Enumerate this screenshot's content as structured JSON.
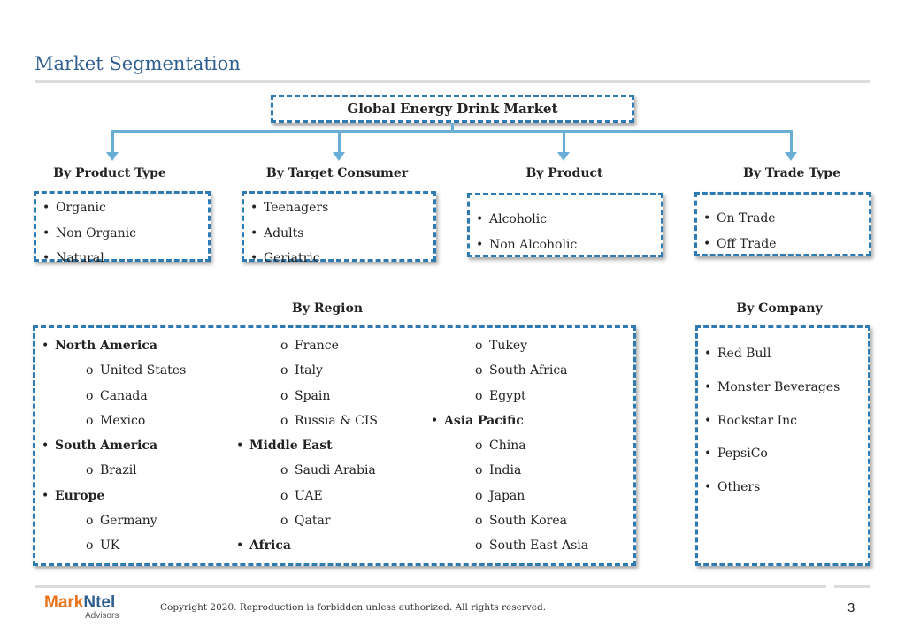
{
  "page": {
    "title": "Market Segmentation"
  },
  "diagram": {
    "root": "Global Energy Drink Market",
    "segments": [
      {
        "heading": "By Product Type",
        "items": [
          "Organic",
          "Non Organic",
          "Natural"
        ]
      },
      {
        "heading": "By Target Consumer",
        "items": [
          "Teenagers",
          "Adults",
          "Geriatric"
        ]
      },
      {
        "heading": "By Product",
        "items": [
          "Alcoholic",
          "Non Alcoholic"
        ]
      },
      {
        "heading": "By Trade Type",
        "items": [
          "On Trade",
          "Off Trade"
        ]
      }
    ],
    "region": {
      "heading": "By Region",
      "columns": [
        [
          {
            "label": "North America",
            "level": "top"
          },
          {
            "label": "United States",
            "level": "sub"
          },
          {
            "label": "Canada",
            "level": "sub"
          },
          {
            "label": "Mexico",
            "level": "sub"
          },
          {
            "label": "South America",
            "level": "top"
          },
          {
            "label": "Brazil",
            "level": "sub"
          },
          {
            "label": "Europe",
            "level": "top"
          },
          {
            "label": "Germany",
            "level": "sub"
          },
          {
            "label": "UK",
            "level": "sub"
          }
        ],
        [
          {
            "label": "France",
            "level": "sub"
          },
          {
            "label": "Italy",
            "level": "sub"
          },
          {
            "label": "Spain",
            "level": "sub"
          },
          {
            "label": "Russia & CIS",
            "level": "sub"
          },
          {
            "label": "Middle East",
            "level": "top"
          },
          {
            "label": "Saudi Arabia",
            "level": "sub"
          },
          {
            "label": "UAE",
            "level": "sub"
          },
          {
            "label": "Qatar",
            "level": "sub"
          },
          {
            "label": "Africa",
            "level": "top"
          }
        ],
        [
          {
            "label": "Tukey",
            "level": "sub"
          },
          {
            "label": "South Africa",
            "level": "sub"
          },
          {
            "label": "Egypt",
            "level": "sub"
          },
          {
            "label": "Asia Pacific",
            "level": "top"
          },
          {
            "label": "China",
            "level": "sub"
          },
          {
            "label": "India",
            "level": "sub"
          },
          {
            "label": "Japan",
            "level": "sub"
          },
          {
            "label": "South Korea",
            "level": "sub"
          },
          {
            "label": "South East Asia",
            "level": "sub"
          }
        ]
      ]
    },
    "company": {
      "heading": "By Company",
      "items": [
        "Red Bull",
        "Monster Beverages",
        "Rockstar Inc",
        "PepsiCo",
        "Others"
      ]
    }
  },
  "footer": {
    "logo_mark": "Mark",
    "logo_ntel": "Ntel",
    "logo_sub": "Advisors",
    "copyright": "Copyright 2020. Reproduction is forbidden unless authorized. All rights reserved.",
    "page_number": "3"
  },
  "colors": {
    "accent": "#2e7bb4",
    "connector": "#6aaed8",
    "title": "#2f5f8f",
    "logo_orange": "#e8731c"
  }
}
